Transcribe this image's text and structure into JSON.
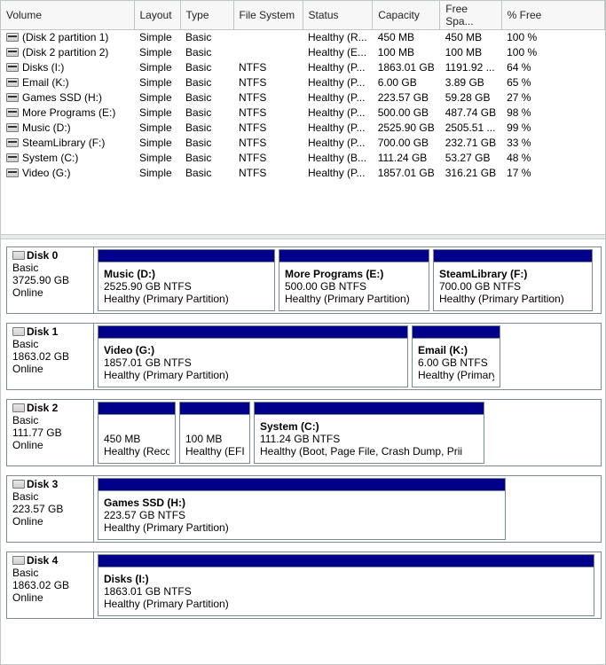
{
  "columns": {
    "volume": "Volume",
    "layout": "Layout",
    "type": "Type",
    "fs": "File System",
    "status": "Status",
    "capacity": "Capacity",
    "free": "Free Spa...",
    "pct": "% Free"
  },
  "volumes": [
    {
      "name": "(Disk 2 partition 1)",
      "layout": "Simple",
      "type": "Basic",
      "fs": "",
      "status": "Healthy (R...",
      "capacity": "450 MB",
      "free": "450 MB",
      "pct": "100 %"
    },
    {
      "name": "(Disk 2 partition 2)",
      "layout": "Simple",
      "type": "Basic",
      "fs": "",
      "status": "Healthy (E...",
      "capacity": "100 MB",
      "free": "100 MB",
      "pct": "100 %"
    },
    {
      "name": "Disks (I:)",
      "layout": "Simple",
      "type": "Basic",
      "fs": "NTFS",
      "status": "Healthy (P...",
      "capacity": "1863.01 GB",
      "free": "1191.92 ...",
      "pct": "64 %"
    },
    {
      "name": "Email (K:)",
      "layout": "Simple",
      "type": "Basic",
      "fs": "NTFS",
      "status": "Healthy (P...",
      "capacity": "6.00 GB",
      "free": "3.89 GB",
      "pct": "65 %"
    },
    {
      "name": "Games SSD (H:)",
      "layout": "Simple",
      "type": "Basic",
      "fs": "NTFS",
      "status": "Healthy (P...",
      "capacity": "223.57 GB",
      "free": "59.28 GB",
      "pct": "27 %"
    },
    {
      "name": "More Programs (E:)",
      "layout": "Simple",
      "type": "Basic",
      "fs": "NTFS",
      "status": "Healthy (P...",
      "capacity": "500.00 GB",
      "free": "487.74 GB",
      "pct": "98 %"
    },
    {
      "name": "Music (D:)",
      "layout": "Simple",
      "type": "Basic",
      "fs": "NTFS",
      "status": "Healthy (P...",
      "capacity": "2525.90 GB",
      "free": "2505.51 ...",
      "pct": "99 %"
    },
    {
      "name": "SteamLibrary (F:)",
      "layout": "Simple",
      "type": "Basic",
      "fs": "NTFS",
      "status": "Healthy (P...",
      "capacity": "700.00 GB",
      "free": "232.71 GB",
      "pct": "33 %"
    },
    {
      "name": "System (C:)",
      "layout": "Simple",
      "type": "Basic",
      "fs": "NTFS",
      "status": "Healthy (B...",
      "capacity": "111.24 GB",
      "free": "53.27 GB",
      "pct": "48 %"
    },
    {
      "name": "Video (G:)",
      "layout": "Simple",
      "type": "Basic",
      "fs": "NTFS",
      "status": "Healthy (P...",
      "capacity": "1857.01 GB",
      "free": "316.21 GB",
      "pct": "17 %"
    }
  ],
  "disks": [
    {
      "label": "Disk 0",
      "type": "Basic",
      "size": "3725.90 GB",
      "state": "Online",
      "parts": [
        {
          "title": "Music  (D:)",
          "sub": "2525.90 GB NTFS",
          "status": "Healthy (Primary Partition)",
          "flex": 200
        },
        {
          "title": "More Programs  (E:)",
          "sub": "500.00 GB NTFS",
          "status": "Healthy (Primary Partition)",
          "flex": 170
        },
        {
          "title": "SteamLibrary  (F:)",
          "sub": "700.00 GB NTFS",
          "status": "Healthy (Primary Partition)",
          "flex": 180
        }
      ]
    },
    {
      "label": "Disk 1",
      "type": "Basic",
      "size": "1863.02 GB",
      "state": "Online",
      "parts": [
        {
          "title": "Video  (G:)",
          "sub": "1857.01 GB NTFS",
          "status": "Healthy (Primary Partition)",
          "flex": 350
        },
        {
          "title": "Email  (K:)",
          "sub": "6.00 GB NTFS",
          "status": "Healthy (Primary Partition)",
          "flex": 100
        }
      ]
    },
    {
      "label": "Disk 2",
      "type": "Basic",
      "size": "111.77 GB",
      "state": "Online",
      "parts": [
        {
          "title": "",
          "sub": "450 MB",
          "status": "Healthy (Recovery P",
          "flex": 88
        },
        {
          "title": "",
          "sub": "100 MB",
          "status": "Healthy (EFI Sy",
          "flex": 80
        },
        {
          "title": "System  (C:)",
          "sub": "111.24 GB NTFS",
          "status": "Healthy (Boot, Page File, Crash Dump, Prii",
          "flex": 260
        }
      ]
    },
    {
      "label": "Disk 3",
      "type": "Basic",
      "size": "223.57 GB",
      "state": "Online",
      "parts": [
        {
          "title": "Games SSD  (H:)",
          "sub": "223.57 GB NTFS",
          "status": "Healthy (Primary Partition)",
          "flex": 460
        }
      ]
    },
    {
      "label": "Disk 4",
      "type": "Basic",
      "size": "1863.02 GB",
      "state": "Online",
      "parts": [
        {
          "title": "Disks  (I:)",
          "sub": "1863.01 GB NTFS",
          "status": "Healthy (Primary Partition)",
          "flex": 560
        }
      ]
    }
  ]
}
